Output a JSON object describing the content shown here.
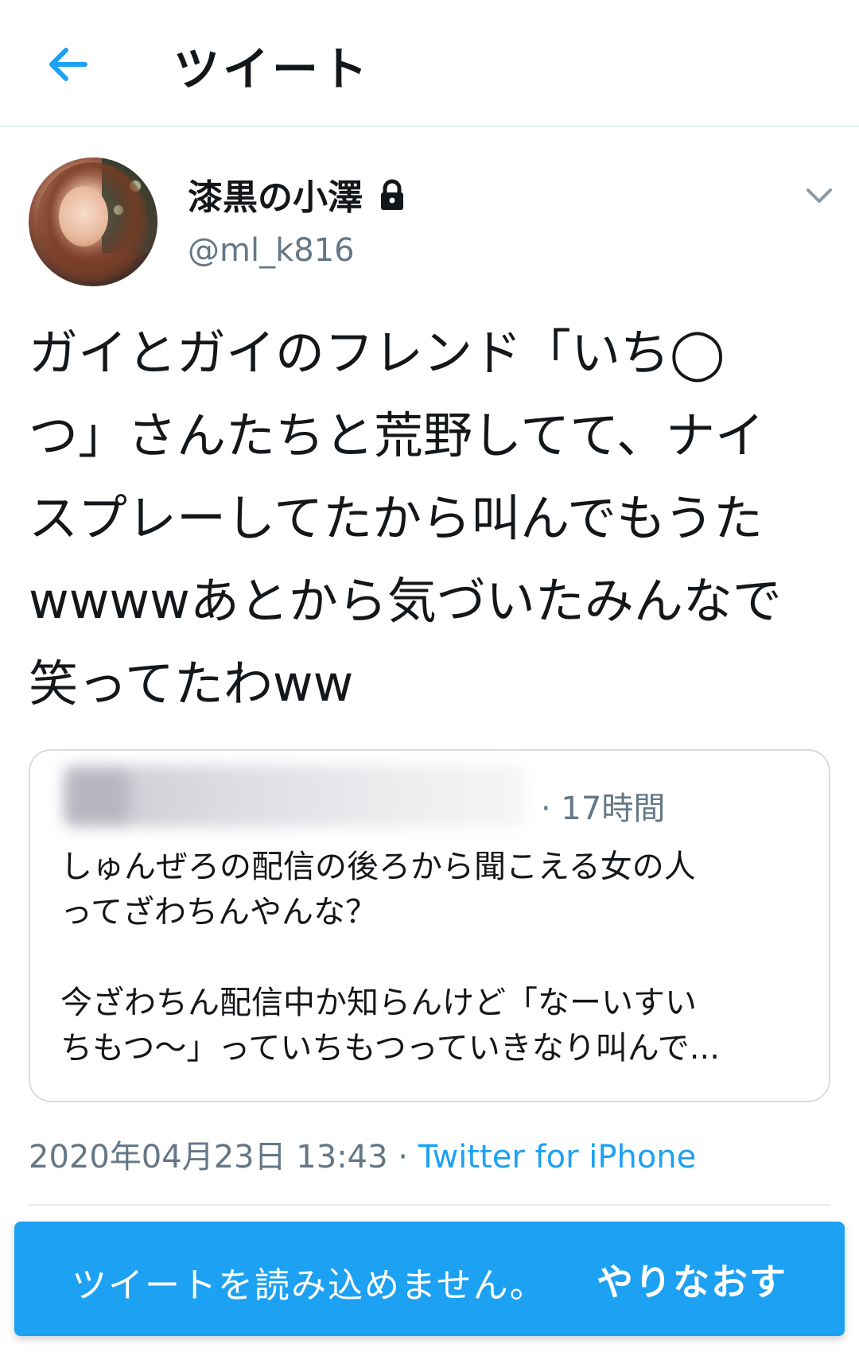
{
  "header": {
    "title": "ツイート",
    "back_icon": "arrow-left-icon",
    "accent": "#1da1f2"
  },
  "tweet": {
    "user": {
      "name": "漆黒の小澤",
      "handle": "@ml_k816",
      "protected_icon": "lock-icon"
    },
    "menu_icon": "chevron-down-icon",
    "text_lines": [
      "ガイとガイのフレンド「いち◯",
      "つ」さんたちと荒野してて、ナイ",
      "スプレーしてたから叫んでもうた",
      "wwwwあとから気づいたみんなで",
      "笑ってたわww"
    ],
    "quote": {
      "time": "· 17時間",
      "text_lines": [
        "しゅんぜろの配信の後ろから聞こえる女の人",
        "ってざわちんやんな？",
        "",
        "今ざわちん配信中か知らんけど「なーいすい",
        "ちもつ〜」っていちもつっていきなり叫んで..."
      ]
    },
    "timestamp": "2020年04月23日 13:43",
    "separator": " · ",
    "source": "Twitter for iPhone"
  },
  "toast": {
    "message": "ツイートを読み込めません。",
    "action": "やりなおす",
    "color": "#1da1f2"
  }
}
